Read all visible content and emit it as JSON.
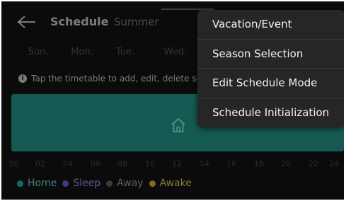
{
  "header": {
    "title": "Schedule",
    "subtitle": "Summer"
  },
  "days": [
    "Sun.",
    "Mon.",
    "Tue.",
    "Wed."
  ],
  "hint": {
    "text": "Tap the timetable to add, edit, delete sc",
    "icon": "info-icon"
  },
  "timeline": {
    "color": "#145a52",
    "icon": "home-icon"
  },
  "hours": [
    "00",
    "02",
    "04",
    "06",
    "08",
    "10",
    "12",
    "14",
    "16",
    "18",
    "20",
    "22",
    "24"
  ],
  "legend": [
    {
      "label": "Home",
      "color": "#0f6f67"
    },
    {
      "label": "Sleep",
      "color": "#3d3a8a"
    },
    {
      "label": "Away",
      "color": "#3a3a3a"
    },
    {
      "label": "Awake",
      "color": "#7b7020"
    }
  ],
  "menu": {
    "items": [
      "Vacation/Event",
      "Season Selection",
      "Edit Schedule Mode",
      "Schedule Initialization"
    ]
  }
}
